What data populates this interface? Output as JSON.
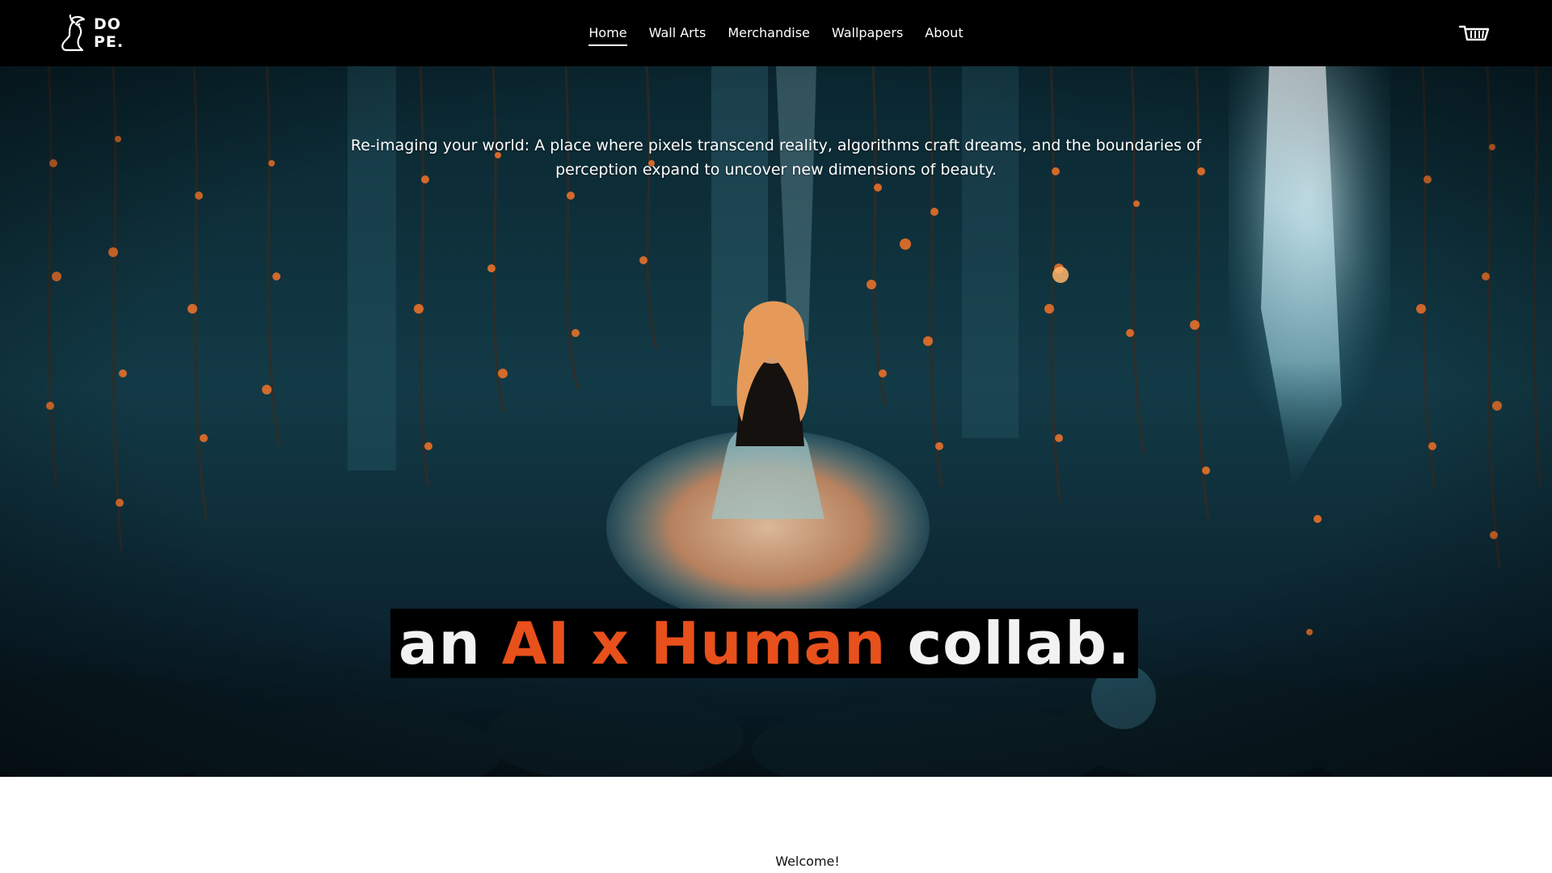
{
  "brand": {
    "logo_text": "DO\nPE.",
    "logo_icon": "rabbit-icon"
  },
  "nav": {
    "items": [
      {
        "label": "Home",
        "active": true
      },
      {
        "label": "Wall Arts",
        "active": false
      },
      {
        "label": "Merchandise",
        "active": false
      },
      {
        "label": "Wallpapers",
        "active": false
      },
      {
        "label": "About",
        "active": false
      }
    ],
    "cart_icon": "cart-icon"
  },
  "hero": {
    "subtitle": "Re-imaging your world: A place where pixels transcend reality, algorithms craft dreams, and the boundaries of perception expand to uncover new dimensions of beauty.",
    "headline": {
      "part1": "an ",
      "part2": "AI x Human",
      "part3": " collab."
    }
  },
  "welcome": {
    "text": "Welcome!"
  },
  "colors": {
    "header_bg": "#000000",
    "accent": "#e8501c",
    "headline_white": "#f2f2f2",
    "hero_teal": "#0e2b35"
  }
}
